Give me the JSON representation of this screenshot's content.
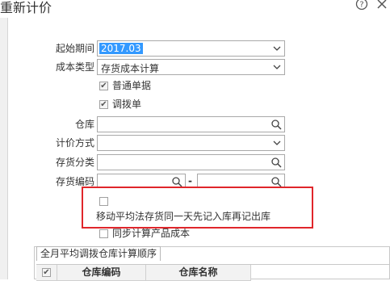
{
  "dialog": {
    "title": "重新计价",
    "help_icon": "help-circle-icon",
    "close_icon": "close-icon"
  },
  "form": {
    "start_period": {
      "label": "起始期间",
      "value": "2017.03"
    },
    "cost_type": {
      "label": "成本类型",
      "value": "存货成本计算"
    },
    "normal_docs": {
      "label": "普通单据",
      "checked": true
    },
    "transfer_docs": {
      "label": "调拨单",
      "checked": true
    },
    "warehouse": {
      "label": "仓库",
      "value": ""
    },
    "pricing_method": {
      "label": "计价方式",
      "value": ""
    },
    "inventory_category": {
      "label": "存货分类",
      "value": ""
    },
    "inventory_code": {
      "label": "存货编码",
      "from": "",
      "to": "",
      "separator": "-"
    },
    "moving_avg_option": {
      "label": "移动平均法存货同一天先记入库再记出库",
      "checked": false
    },
    "sync_product_cost": {
      "label": "同步计算产品成本",
      "checked": false
    }
  },
  "transfer_panel": {
    "tab_label": "全月平均调拨仓库计算顺序",
    "columns": [
      "仓库编码",
      "仓库名称"
    ]
  },
  "colors": {
    "highlight": "#3399ff",
    "callout_border": "#e0262b"
  }
}
